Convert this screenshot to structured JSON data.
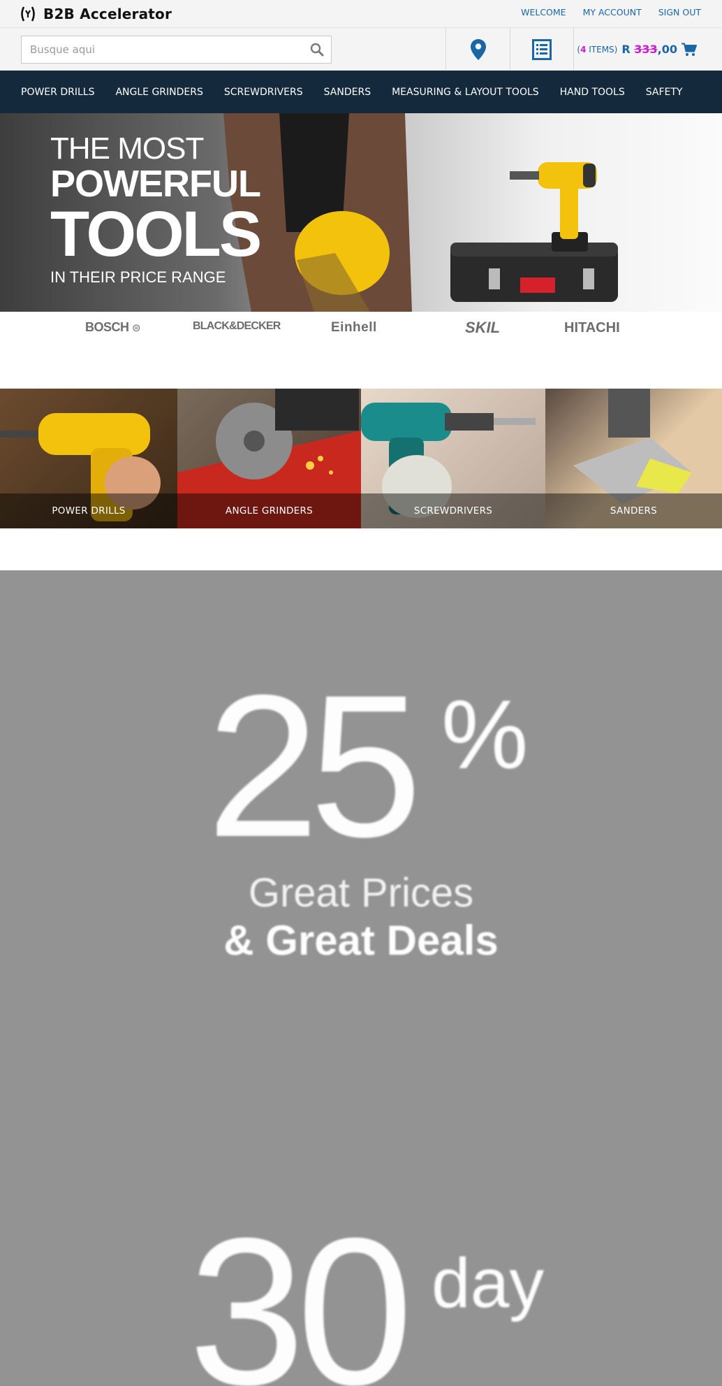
{
  "header": {
    "logo_text": "B2B Accelerator",
    "links": {
      "welcome": "WELCOME",
      "my_account": "MY ACCOUNT",
      "sign_out": "SIGN OUT"
    }
  },
  "search": {
    "placeholder": "Busque aqui"
  },
  "cart": {
    "items_prefix": "(",
    "items_count": "4",
    "items_suffix": " ITEMS)",
    "currency": "R ",
    "amount_struck": "333",
    "amount_tail": ",00"
  },
  "nav": {
    "items": [
      "POWER DRILLS",
      "ANGLE GRINDERS",
      "SCREWDRIVERS",
      "SANDERS",
      "MEASURING & LAYOUT TOOLS",
      "HAND TOOLS",
      "SAFETY"
    ]
  },
  "hero": {
    "line1": "THE MOST",
    "line2": "POWERFUL",
    "line3": "TOOLS",
    "line4": "IN THEIR PRICE RANGE"
  },
  "brands": [
    "BOSCH",
    "BLACK&DECKER",
    "Einhell",
    "SKIL",
    "HITACHI"
  ],
  "categories": [
    "POWER DRILLS",
    "ANGLE GRINDERS",
    "SCREWDRIVERS",
    "SANDERS"
  ],
  "promo": {
    "big_number": "25",
    "percent": "%",
    "line1": "Great Prices",
    "line2": "& Great Deals",
    "days_number": "30",
    "days_label": "day"
  },
  "colors": {
    "nav_bg": "#14293c",
    "link_blue": "#1a67a8",
    "accent_magenta": "#d01ad0",
    "promo_bg": "#939393"
  }
}
